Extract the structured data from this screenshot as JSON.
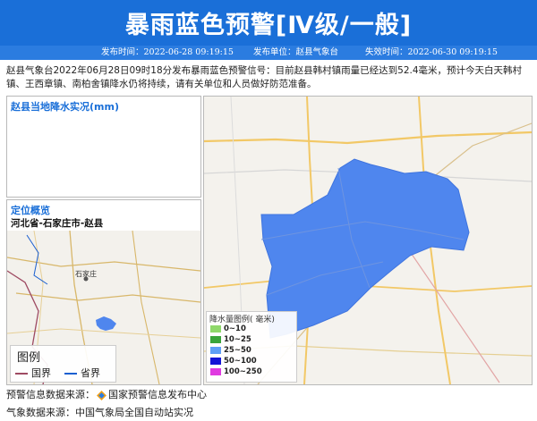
{
  "header": {
    "title": "暴雨蓝色预警[Ⅳ级/一般]",
    "issue_time": "发布时间：2022-06-28 09:19:15",
    "issuer": "发布单位：赵县气象台",
    "expire_time": "失效时间：2022-06-30 09:19:15"
  },
  "description": "赵县气象台2022年06月28日09时18分发布暴雨蓝色预警信号：目前赵县韩村镇雨量已经达到52.4毫米，预计今天白天韩村镇、王西章镇、南柏舍镇降水仍将持续，请有关单位和人员做好防范准备。",
  "rain_panel": {
    "title": "赵县当地降水实况(mm)"
  },
  "location_panel": {
    "title": "定位概览",
    "path": "河北省-石家庄市-赵县",
    "city_label": "石家庄",
    "legend_title": "图例",
    "national_border": "国界",
    "provincial_border": "省界"
  },
  "rain_legend": {
    "title": "降水量图例( 毫米)",
    "levels": [
      {
        "label": "0~10",
        "color": "#8fd86a"
      },
      {
        "label": "10~25",
        "color": "#3aa53a"
      },
      {
        "label": "25~50",
        "color": "#5f9ff5"
      },
      {
        "label": "50~100",
        "color": "#1414d6"
      },
      {
        "label": "100~250",
        "color": "#e03ae0"
      }
    ]
  },
  "footer": {
    "source1_label": "预警信息数据来源：",
    "source1_value": "国家预警信息发布中心",
    "source2": "气象数据来源：中国气象局全国自动站实况"
  },
  "colors": {
    "header_blue": "#1a6fd8",
    "county_fill": "#4f86ee",
    "national_border": "#9e4a62",
    "provincial_border": "#1a5fd0"
  }
}
